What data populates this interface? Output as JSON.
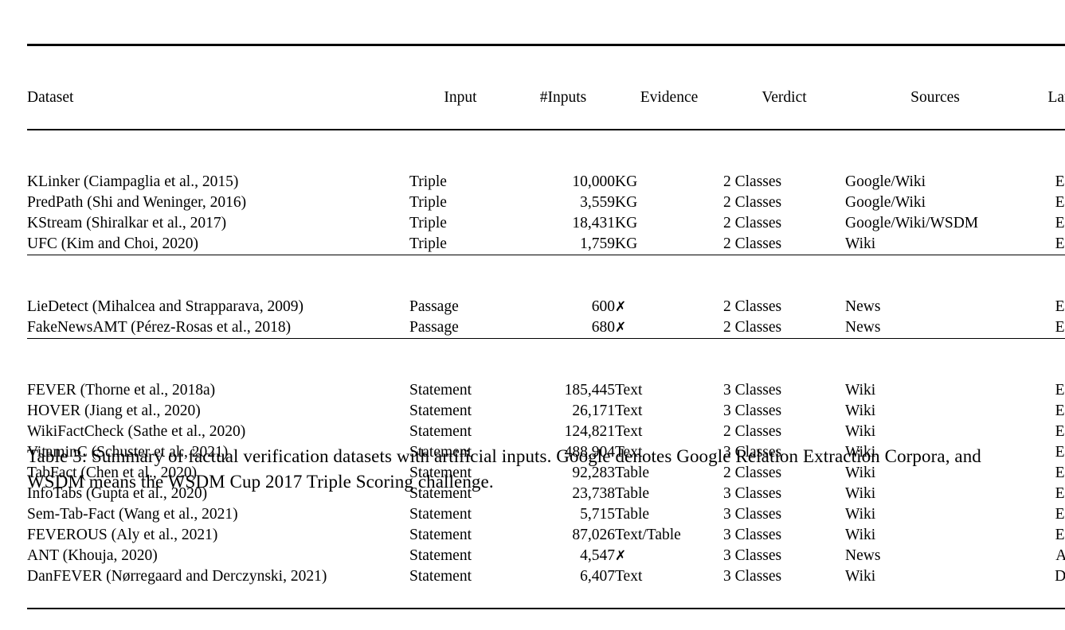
{
  "table": {
    "columns": [
      {
        "key": "dataset",
        "label": "Dataset"
      },
      {
        "key": "input",
        "label": "Input"
      },
      {
        "key": "ninputs",
        "label": "#Inputs"
      },
      {
        "key": "evidence",
        "label": "Evidence"
      },
      {
        "key": "verdict",
        "label": "Verdict"
      },
      {
        "key": "sources",
        "label": "Sources"
      },
      {
        "key": "lang",
        "label": "Lang"
      }
    ],
    "groups": [
      {
        "rows": [
          {
            "dataset": "KLinker (Ciampaglia et al., 2015)",
            "input": "Triple",
            "ninputs": "10,000",
            "evidence": "KG",
            "verdict": "2 Classes",
            "sources": "Google/Wiki",
            "lang": "En"
          },
          {
            "dataset": "PredPath (Shi and Weninger, 2016)",
            "input": "Triple",
            "ninputs": "3,559",
            "evidence": "KG",
            "verdict": "2 Classes",
            "sources": "Google/Wiki",
            "lang": "En"
          },
          {
            "dataset": "KStream (Shiralkar et al., 2017)",
            "input": "Triple",
            "ninputs": "18,431",
            "evidence": "KG",
            "verdict": "2 Classes",
            "sources": "Google/Wiki/WSDM",
            "lang": "En"
          },
          {
            "dataset": "UFC (Kim and Choi, 2020)",
            "input": "Triple",
            "ninputs": "1,759",
            "evidence": "KG",
            "verdict": "2 Classes",
            "sources": "Wiki",
            "lang": "En"
          }
        ]
      },
      {
        "rows": [
          {
            "dataset": "LieDetect (Mihalcea and Strapparava, 2009)",
            "input": "Passage",
            "ninputs": "600",
            "evidence": "✗",
            "verdict": "2 Classes",
            "sources": "News",
            "lang": "En"
          },
          {
            "dataset": "FakeNewsAMT (Pérez-Rosas et al., 2018)",
            "input": "Passage",
            "ninputs": "680",
            "evidence": "✗",
            "verdict": "2 Classes",
            "sources": "News",
            "lang": "En"
          }
        ]
      },
      {
        "rows": [
          {
            "dataset": "FEVER (Thorne et al., 2018a)",
            "input": "Statement",
            "ninputs": "185,445",
            "evidence": "Text",
            "verdict": "3 Classes",
            "sources": "Wiki",
            "lang": "En"
          },
          {
            "dataset": "HOVER (Jiang et al., 2020)",
            "input": "Statement",
            "ninputs": "26,171",
            "evidence": "Text",
            "verdict": "3 Classes",
            "sources": "Wiki",
            "lang": "En"
          },
          {
            "dataset": "WikiFactCheck (Sathe et al., 2020)",
            "input": "Statement",
            "ninputs": "124,821",
            "evidence": "Text",
            "verdict": "2 Classes",
            "sources": "Wiki",
            "lang": "En"
          },
          {
            "dataset": "VitaminC (Schuster et al., 2021)",
            "input": "Statement",
            "ninputs": "488,904",
            "evidence": "Text",
            "verdict": "3 Classes",
            "sources": "Wiki",
            "lang": "En"
          },
          {
            "dataset": "TabFact (Chen et al., 2020)",
            "input": "Statement",
            "ninputs": "92,283",
            "evidence": "Table",
            "verdict": "2 Classes",
            "sources": "Wiki",
            "lang": "En"
          },
          {
            "dataset": "InfoTabs (Gupta et al., 2020)",
            "input": "Statement",
            "ninputs": "23,738",
            "evidence": "Table",
            "verdict": "3 Classes",
            "sources": "Wiki",
            "lang": "En"
          },
          {
            "dataset": "Sem-Tab-Fact (Wang et al., 2021)",
            "input": "Statement",
            "ninputs": "5,715",
            "evidence": "Table",
            "verdict": "3 Classes",
            "sources": "Wiki",
            "lang": "En"
          },
          {
            "dataset": "FEVEROUS (Aly et al., 2021)",
            "input": "Statement",
            "ninputs": "87,026",
            "evidence": "Text/Table",
            "verdict": "3 Classes",
            "sources": "Wiki",
            "lang": "En"
          },
          {
            "dataset": "ANT (Khouja, 2020)",
            "input": "Statement",
            "ninputs": "4,547",
            "evidence": "✗",
            "verdict": "3 Classes",
            "sources": "News",
            "lang": "Ar"
          },
          {
            "dataset": "DanFEVER (Nørregaard and Derczynski, 2021)",
            "input": "Statement",
            "ninputs": "6,407",
            "evidence": "Text",
            "verdict": "3 Classes",
            "sources": "Wiki",
            "lang": "Da"
          }
        ]
      }
    ]
  },
  "caption": {
    "text": "Table 3: Summary of factual verification datasets with artificial inputs. Google denotes Google Relation Extraction Corpora, and WSDM means the WSDM Cup 2017 Triple Scoring challenge."
  }
}
